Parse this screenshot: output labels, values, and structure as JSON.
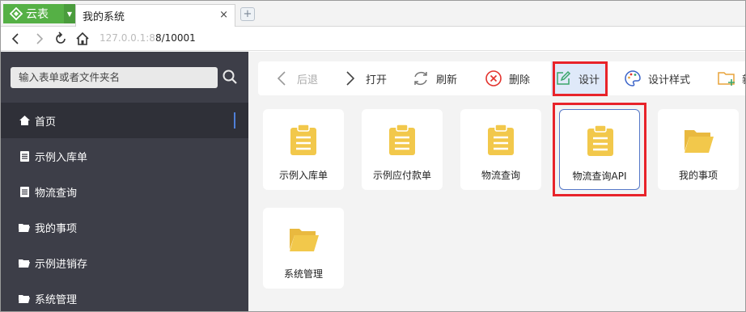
{
  "browser": {
    "brand": "云表",
    "tab_title": "我的系统",
    "tab_close": "×",
    "new_tab": "+",
    "url_dim": "127.0.0.1:8",
    "url_rest": "8/10001"
  },
  "sidebar": {
    "search_placeholder": "输入表单或者文件夹名",
    "items": [
      {
        "label": "首页",
        "icon": "home-icon",
        "active": true
      },
      {
        "label": "示例入库单",
        "icon": "document-icon"
      },
      {
        "label": "物流查询",
        "icon": "document-icon"
      },
      {
        "label": "我的事项",
        "icon": "folder-icon"
      },
      {
        "label": "示例进销存",
        "icon": "folder-icon"
      },
      {
        "label": "系统管理",
        "icon": "folder-icon"
      }
    ]
  },
  "toolbar": {
    "back": "后退",
    "open": "打开",
    "refresh": "刷新",
    "delete": "删除",
    "design": "设计",
    "design_style": "设计样式",
    "new_partial": "新"
  },
  "cards": [
    {
      "label": "示例入库单",
      "icon": "clipboard-icon"
    },
    {
      "label": "示例应付款单",
      "icon": "clipboard-icon"
    },
    {
      "label": "物流查询",
      "icon": "clipboard-icon"
    },
    {
      "label": "物流查询API",
      "icon": "clipboard-icon",
      "selected": true
    },
    {
      "label": "我的事项",
      "icon": "folder-icon"
    },
    {
      "label": "系统管理",
      "icon": "folder-icon"
    }
  ],
  "colors": {
    "brand_green": "#55b045",
    "sidebar_bg": "#3d3e48",
    "icon_yellow": "#f2c84b",
    "highlight_red": "#e8232a",
    "accent_blue": "#4f7fd8"
  }
}
